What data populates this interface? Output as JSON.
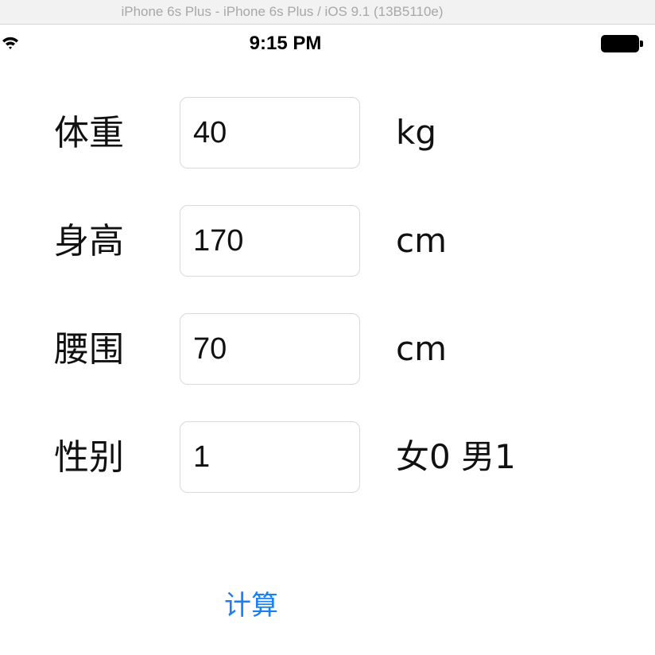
{
  "simulator": {
    "title": "iPhone 6s Plus - iPhone 6s Plus / iOS 9.1 (13B5110e)"
  },
  "status_bar": {
    "time": "9:15 PM",
    "wifi_icon": "wifi-icon",
    "battery_icon": "battery-icon"
  },
  "form": {
    "rows": [
      {
        "label": "体重",
        "value": "40",
        "unit": "kg"
      },
      {
        "label": "身高",
        "value": "170",
        "unit": "cm"
      },
      {
        "label": "腰围",
        "value": "70",
        "unit": "cm"
      },
      {
        "label": "性别",
        "value": "1",
        "unit": "女0 男1"
      }
    ]
  },
  "actions": {
    "calculate_label": "计算",
    "accent_color": "#1a7ff2"
  }
}
